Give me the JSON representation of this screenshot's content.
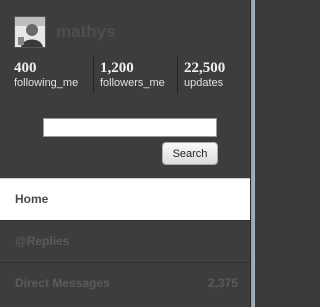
{
  "profile": {
    "username": "mathys"
  },
  "stats": [
    {
      "value": "400",
      "label": "following_me"
    },
    {
      "value": "1,200",
      "label": "followers_me"
    },
    {
      "value": "22,500",
      "label": "updates"
    }
  ],
  "search": {
    "value": "",
    "button_label": "Search"
  },
  "nav": [
    {
      "label": "Home",
      "count": ""
    },
    {
      "label": "@Replies",
      "count": ""
    },
    {
      "label": "Direct Messages",
      "count": "2,375"
    }
  ],
  "colors": {
    "panel": "#3d3d3d",
    "active_item": "#ffffff",
    "muted_text": "#5a5a5a"
  }
}
